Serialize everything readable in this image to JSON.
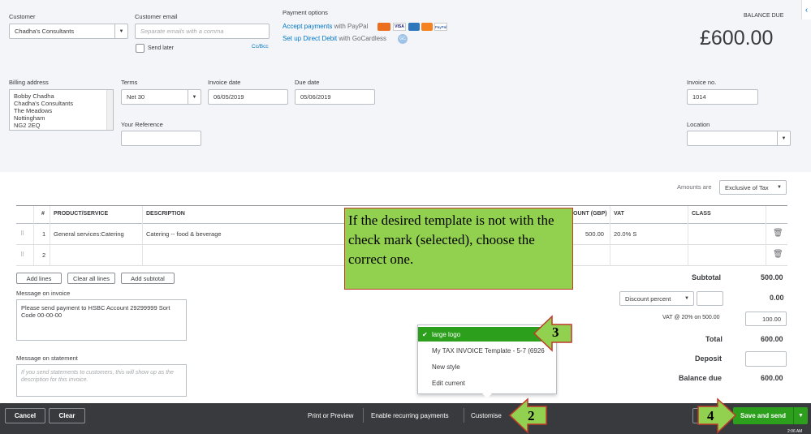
{
  "header": {
    "customer_label": "Customer",
    "customer_value": "Chadha's Consultants",
    "email_label": "Customer email",
    "email_placeholder": "Separate emails with a comma",
    "send_later": "Send later",
    "cc_bcc": "Cc/Bcc",
    "payment_options_label": "Payment options",
    "accept_payments": "Accept payments",
    "with_paypal": " with PayPal",
    "direct_debit": "Set up Direct Debit",
    "with_gocardless": " with GoCardless",
    "gocardless_badge": "GC",
    "card_labels": [
      "VISA",
      "PayPal"
    ],
    "balance_due_label": "BALANCE DUE",
    "balance_due_value": "£600.00"
  },
  "billing": {
    "address_label": "Billing address",
    "address_lines": [
      "Bobby Chadha",
      "Chadha's Consultants",
      "The Meadows",
      "Nottingham",
      "NG2 2EQ"
    ],
    "terms_label": "Terms",
    "terms_value": "Net 30",
    "invoice_date_label": "Invoice date",
    "invoice_date_value": "06/05/2019",
    "due_date_label": "Due date",
    "due_date_value": "05/06/2019",
    "your_reference_label": "Your Reference",
    "invoice_no_label": "Invoice no.",
    "invoice_no_value": "1014",
    "location_label": "Location"
  },
  "table": {
    "amounts_are_label": "Amounts are",
    "amounts_are_value": "Exclusive of Tax",
    "headers": {
      "num": "#",
      "product": "PRODUCT/SERVICE",
      "description": "DESCRIPTION",
      "amount": "OUNT (GBP)",
      "vat": "VAT",
      "class": "CLASS"
    },
    "rows": [
      {
        "num": "1",
        "product": "General services:Catering",
        "description": "Catering -- food & beverage",
        "amount": "500.00",
        "vat": "20.0% S"
      },
      {
        "num": "2",
        "product": "",
        "description": "",
        "amount": "",
        "vat": ""
      }
    ],
    "add_lines": "Add lines",
    "clear_all_lines": "Clear all lines",
    "add_subtotal": "Add subtotal"
  },
  "messages": {
    "invoice_label": "Message on invoice",
    "invoice_text": "Please send payment to HSBC Account 29299999 Sort Code 00-00-00",
    "statement_label": "Message on statement",
    "statement_placeholder": "If you send statements to customers, this will show up as the description for this invoice."
  },
  "totals": {
    "subtotal_label": "Subtotal",
    "subtotal_value": "500.00",
    "discount_select": "Discount percent",
    "discount_value": "0.00",
    "vat_label": "VAT @ 20% on 500.00",
    "vat_value": "100.00",
    "total_label": "Total",
    "total_value": "600.00",
    "deposit_label": "Deposit",
    "balance_due_label": "Balance due",
    "balance_due_value": "600.00"
  },
  "customise_menu": {
    "items": [
      "large logo",
      "My TAX INVOICE Template - 5-7 (6926",
      "New style",
      "Edit current"
    ]
  },
  "callout": {
    "text": "If the desired template is not with the check mark (selected), choose the correct one."
  },
  "badges": [
    "3",
    "2",
    "4"
  ],
  "footer": {
    "cancel": "Cancel",
    "clear": "Clear",
    "print_preview": "Print or Preview",
    "recurring": "Enable recurring payments",
    "customise": "Customise",
    "save_send": "Save and send",
    "clock": "2:06 AM"
  },
  "colors": {
    "accent_green": "#2ca01c",
    "link_blue": "#0077c5",
    "callout_green": "#92d050",
    "footer_bg": "#393a3d"
  }
}
